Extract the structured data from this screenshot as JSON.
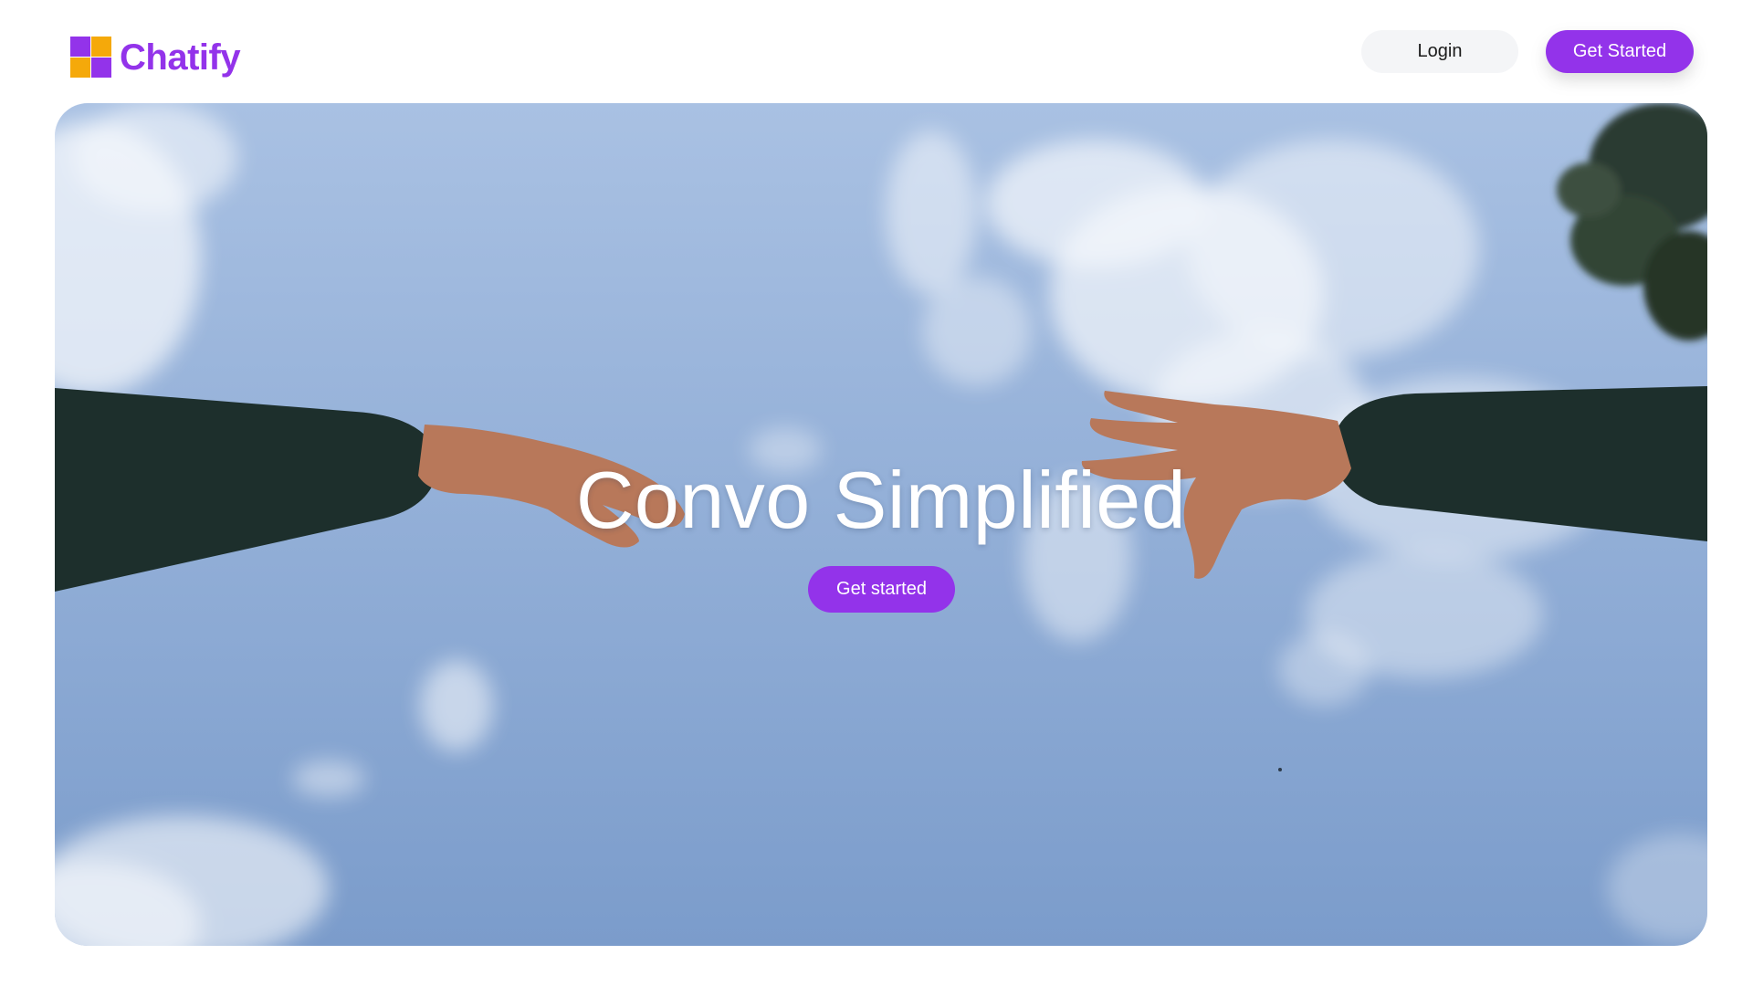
{
  "brand": {
    "name": "Chatify",
    "logo_colors": [
      "#9333ea",
      "#f5a90a",
      "#f5a90a",
      "#9333ea"
    ],
    "text_color": "#9333ea"
  },
  "nav": {
    "login_label": "Login",
    "get_started_label": "Get Started"
  },
  "hero": {
    "title": "Convo Simplified",
    "cta_label": "Get started",
    "background_image": "sky-with-reaching-hands-photo"
  },
  "colors": {
    "accent": "#9333ea",
    "login_bg": "#f4f5f7",
    "sky_top": "#a9c1e3",
    "sky_bottom": "#7b9ccb",
    "sleeve": "#1d2f2c",
    "skin": "#b8785a"
  }
}
